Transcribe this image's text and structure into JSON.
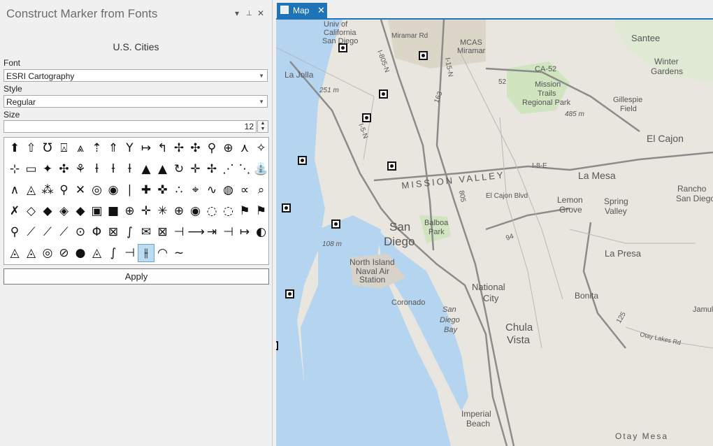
{
  "pane": {
    "title": "Construct Marker from Fonts",
    "menu_icon": "▾",
    "pin_icon": "📌",
    "close_icon": "✕",
    "layer_name": "U.S. Cities",
    "font_label": "Font",
    "font_value": "ESRI Cartography",
    "style_label": "Style",
    "style_value": "Regular",
    "size_label": "Size",
    "size_value": "12",
    "apply_label": "Apply",
    "selected_glyph_index": 88,
    "glyphs": [
      "⬆",
      "⇧",
      "Ʊ",
      "⍓",
      "⩓",
      "⇡",
      "⇑",
      "Y",
      "↦",
      "↰",
      "✢",
      "✣",
      "⚲",
      "⊕",
      "⋏",
      "✧",
      "⊹",
      "▭",
      "✦",
      "✣",
      "⚘",
      "ƚ",
      "ƚ",
      "ƚ",
      "▲",
      "▲",
      "↻",
      "✛",
      "✢",
      "⋰",
      "⋱",
      "⛲",
      "∧",
      "◬",
      "⁂",
      "⚲",
      "✕",
      "◎",
      "◉",
      "∣",
      "✚",
      "✜",
      "∴",
      "⌖",
      "∿",
      "◍",
      "∝",
      "⌕",
      "✗",
      "◇",
      "◆",
      "◈",
      "◆",
      "▣",
      "■",
      "⊕",
      "✛",
      "✳",
      "⊕",
      "◉",
      "◌",
      "◌",
      "⚑",
      "⚑",
      "⚲",
      "⟋",
      "⟋",
      "⟋",
      "⊙",
      "Φ",
      "⊠",
      "∫",
      "✉",
      "⊠",
      "⊣",
      "⟶",
      "⇥",
      "⊣",
      "↦",
      "◐",
      "◬",
      "◬",
      "◎",
      "⊘",
      "●",
      "◬",
      "∫",
      "⊣",
      "⫲",
      "◠",
      "~"
    ]
  },
  "map": {
    "tab_label": "Map",
    "tab_close": "✕",
    "labels": [
      "Univ of California San Diego",
      "Miramar Rd",
      "MCAS Miramar",
      "Santee",
      "Winter Gardens",
      "La Jolla",
      "251 m",
      "CA-52",
      "Mission Trails Regional Park",
      "485 m",
      "Gillespie Field",
      "El Cajon",
      "MISSION VALLEY",
      "La Mesa",
      "El Cajon Blvd",
      "Lemon Grove",
      "Spring Valley",
      "Rancho San Diego",
      "San Diego",
      "Balboa Park",
      "108 m",
      "North Island Naval Air Station",
      "La Presa",
      "National City",
      "Bonita",
      "Coronado",
      "San Diego Bay",
      "Chula Vista",
      "Otay Lakes Rd",
      "Imperial Beach",
      "Otay Mesa",
      "I-805-N",
      "I-15-N",
      "I-5-N",
      "I-8-E",
      "805",
      "94",
      "125",
      "163",
      "52",
      "Jamul"
    ],
    "marker_count": 14
  },
  "colors": {
    "tab_blue": "#1f73b7",
    "water": "#b5d4ef",
    "land": "#e9e6df",
    "park": "#cfe4bf"
  }
}
